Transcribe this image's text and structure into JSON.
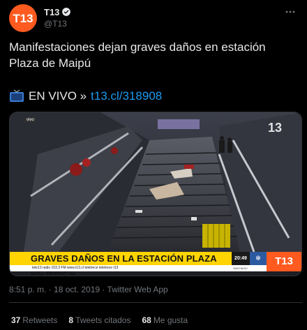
{
  "account": {
    "display_name": "T13",
    "handle": "@T13",
    "avatar_text": "T13",
    "verified": true,
    "brand_color": "#ff5a1f"
  },
  "tweet": {
    "text": "Manifestaciones dejan graves daños en estación Plaza de Maipú",
    "live_prefix": "EN VIVO »",
    "live_link": "t13.cl/318908",
    "live_icon": "tv-icon",
    "timestamp": "8:51 p. m. · 18 oct. 2019 · Twitter Web App"
  },
  "video": {
    "live_tag": "vivo",
    "corner_logo": "13",
    "headline": "GRAVES DAÑOS EN LA ESTACIÓN PLAZA DE MAIPÚ",
    "ticker": "tele13 radio 103.3 FM   www.t13.cl   teletrece   teletrece   t13",
    "clock_time": "20:49",
    "clock_city": "SANTIAGO",
    "channel_logo": "T13",
    "headline_color": "#ffd400"
  },
  "stats": [
    {
      "count": "37",
      "label": "Retweets"
    },
    {
      "count": "8",
      "label": "Tweets citados"
    },
    {
      "count": "68",
      "label": "Me gusta"
    }
  ],
  "colors": {
    "background": "#000000",
    "text": "#e7e9ea",
    "muted": "#71767b",
    "link": "#1d9bf0",
    "border": "#2f3336"
  }
}
